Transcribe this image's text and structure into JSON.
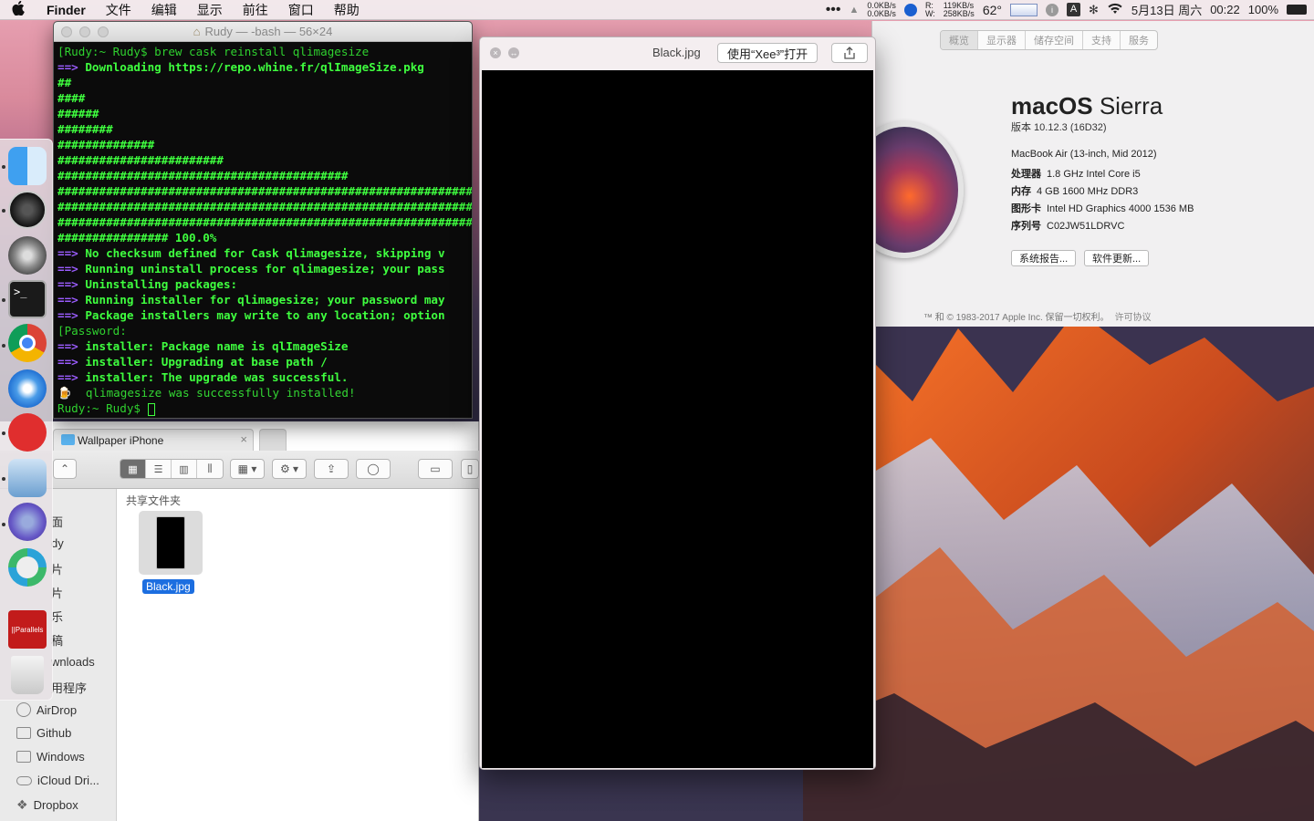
{
  "menubar": {
    "apple": "",
    "items": [
      "Finder",
      "文件",
      "编辑",
      "显示",
      "前往",
      "窗口",
      "帮助"
    ],
    "net_up": "0.0KB/s",
    "net_down": "0.0KB/s",
    "disk_r_label": "R:",
    "disk_w_label": "W:",
    "disk_r": "119KB/s",
    "disk_w": "258KB/s",
    "temp": "62°",
    "date": "5月13日 周六",
    "time": "00:22",
    "battery": "100%",
    "input_method": "A"
  },
  "terminal": {
    "title": "Rudy — -bash — 56×24",
    "lines": [
      {
        "type": "prompt",
        "text": "[Rudy:~ Rudy$ brew cask reinstall qlimagesize"
      },
      {
        "type": "arrow",
        "arrow": "==>",
        "text": " Downloading https://repo.whine.fr/qlImageSize.pkg"
      },
      {
        "type": "bar",
        "text": "##"
      },
      {
        "type": "bar",
        "text": "####"
      },
      {
        "type": "bar",
        "text": "######"
      },
      {
        "type": "bar",
        "text": "########"
      },
      {
        "type": "bar",
        "text": "##############"
      },
      {
        "type": "bar",
        "text": "########################"
      },
      {
        "type": "bar",
        "text": "##########################################"
      },
      {
        "type": "bar",
        "text": "################################################################"
      },
      {
        "type": "bar",
        "text": "################################################################"
      },
      {
        "type": "bar",
        "text": "################################################################"
      },
      {
        "type": "bar",
        "text": "################ 100.0%"
      },
      {
        "type": "arrow",
        "arrow": "==>",
        "text": " No checksum defined for Cask qlimagesize, skipping v"
      },
      {
        "type": "arrow",
        "arrow": "==>",
        "text": " Running uninstall process for qlimagesize; your pass"
      },
      {
        "type": "arrow",
        "arrow": "==>",
        "text": " Uninstalling packages:"
      },
      {
        "type": "arrow",
        "arrow": "==>",
        "text": " Running installer for qlimagesize; your password may"
      },
      {
        "type": "arrow",
        "arrow": "==>",
        "text": " Package installers may write to any location; option"
      },
      {
        "type": "prompt",
        "text": "[Password:"
      },
      {
        "type": "arrow",
        "arrow": "==>",
        "text": " installer: Package name is qlImageSize"
      },
      {
        "type": "arrow",
        "arrow": "==>",
        "text": " installer: Upgrading at base path /"
      },
      {
        "type": "arrow",
        "arrow": "==>",
        "text": " installer: The upgrade was successful."
      },
      {
        "type": "plain",
        "text": "🍺  qlimagesize was successfully installed!"
      },
      {
        "type": "prompt-end",
        "text": "Rudy:~ Rudy$ "
      }
    ]
  },
  "finder": {
    "tab_label": "Wallpaper iPhone",
    "tab_close": "×",
    "section_header": "共享文件夹",
    "file_name": "Black.jpg",
    "sidebar": [
      "面",
      "dy",
      "片",
      "片",
      "乐",
      "稿",
      "wnloads",
      "用程序",
      "AirDrop",
      "Github",
      "Windows",
      "iCloud Dri...",
      "Dropbox"
    ]
  },
  "quicklook": {
    "file_name": "Black.jpg",
    "open_with": "使用“Xee³”打开",
    "close_glyph": "×",
    "fullscreen_glyph": "↔"
  },
  "about": {
    "tabs": [
      "概览",
      "显示器",
      "储存空间",
      "支持",
      "服务"
    ],
    "os_name_bold": "macOS",
    "os_name_light": " Sierra",
    "version": "版本 10.12.3 (16D32)",
    "model": "MacBook Air (13-inch, Mid 2012)",
    "specs": [
      {
        "key": "处理器",
        "value": "1.8 GHz Intel Core i5"
      },
      {
        "key": "内存",
        "value": "4 GB 1600 MHz DDR3"
      },
      {
        "key": "图形卡",
        "value": "Intel HD Graphics 4000 1536 MB"
      },
      {
        "key": "序列号",
        "value": "C02JW51LDRVC"
      }
    ],
    "btn_report": "系统报告...",
    "btn_update": "软件更新...",
    "footer": "™ 和 © 1983-2017 Apple Inc. 保留一切权利。",
    "footer_link": "许可协议"
  },
  "dock": {
    "parallels_label": "||Parallels"
  },
  "colors": {
    "term_green": "#3fff3f",
    "term_arrow": "#9b5cff",
    "finder_selection": "#1c6ee0"
  }
}
